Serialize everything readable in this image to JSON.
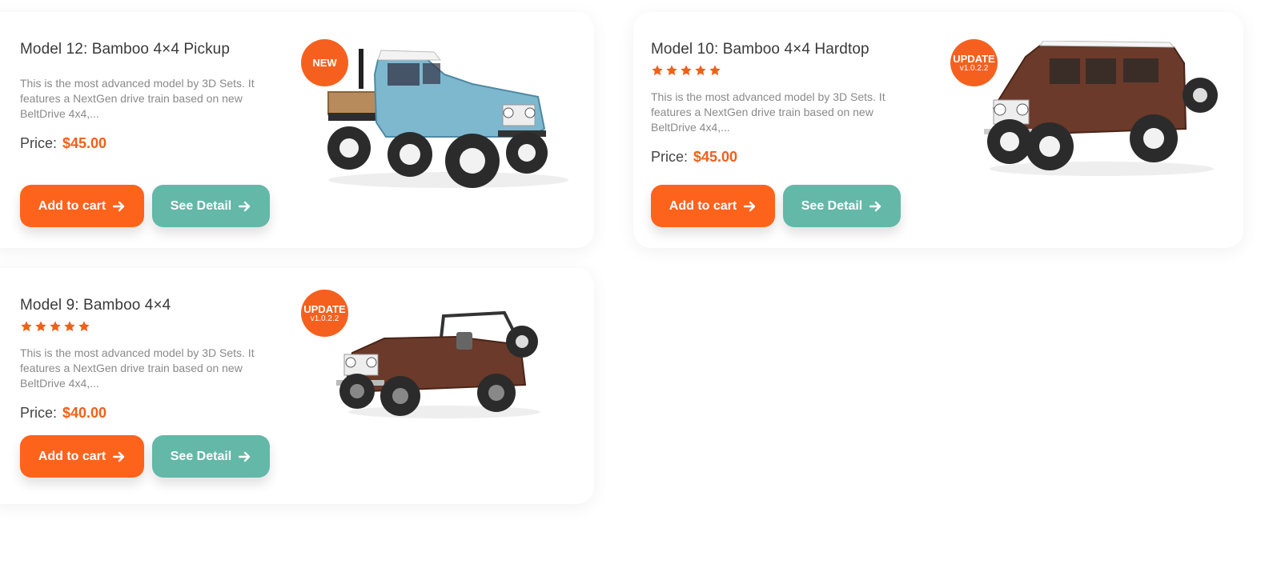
{
  "products": [
    {
      "title": "Model 12: Bamboo 4×4 Pickup",
      "description": "This is the most advanced model by 3D Sets. It features a NextGen drive train based on new BeltDrive 4x4,...",
      "price_label": "Price:",
      "price": "$45.00",
      "badge": {
        "main": "NEW",
        "sub": ""
      },
      "rating": null,
      "add_to_cart_label": "Add to cart",
      "see_detail_label": "See Detail",
      "image": "blue-pickup-truck"
    },
    {
      "title": "Model 10: Bamboo 4×4 Hardtop",
      "description": "This is the most advanced model by 3D Sets. It features a NextGen drive train based on new BeltDrive 4x4,...",
      "price_label": "Price:",
      "price": "$45.00",
      "badge": {
        "main": "UPDATE",
        "sub": "v1.0.2.2"
      },
      "rating": 5,
      "add_to_cart_label": "Add to cart",
      "see_detail_label": "See Detail",
      "image": "brown-hardtop-suv"
    },
    {
      "title": "Model 9: Bamboo 4×4",
      "description": "This is the most advanced model by 3D Sets. It features a NextGen drive train based on new BeltDrive 4x4,...",
      "price_label": "Price:",
      "price": "$40.00",
      "badge": {
        "main": "UPDATE",
        "sub": "v1.0.2.2"
      },
      "rating": 5,
      "add_to_cart_label": "Add to cart",
      "see_detail_label": "See Detail",
      "image": "brown-open-top-4x4"
    }
  ],
  "colors": {
    "accent": "#fe631c",
    "secondary": "#63b8a8",
    "price": "#f0601b",
    "badge": "#f6601e"
  },
  "icons": {
    "arrow": "arrow-right-icon",
    "star": "star-icon"
  }
}
